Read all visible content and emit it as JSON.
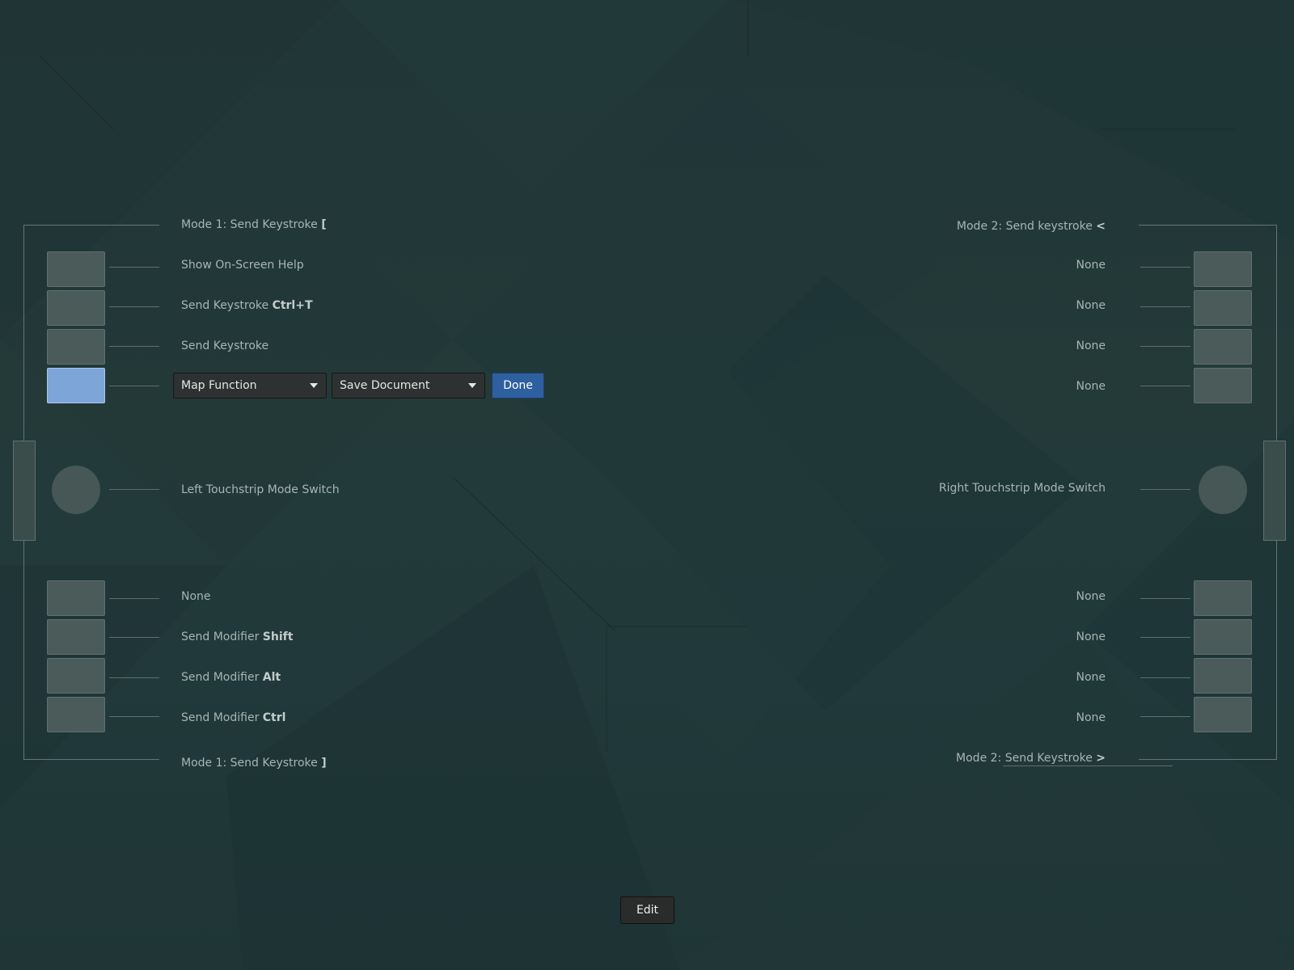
{
  "left": {
    "top_mode": {
      "prefix": "Mode 1: Send Keystroke ",
      "key": "["
    },
    "buttons": [
      {
        "text": "Show On-Screen Help",
        "key": ""
      },
      {
        "text": "Send Keystroke ",
        "key": "Ctrl+T"
      },
      {
        "text": "Send Keystroke",
        "key": ""
      }
    ],
    "mapping": {
      "function": "Map Function",
      "action": "Save Document",
      "done": "Done"
    },
    "touchstrip": "Left Touchstrip Mode Switch",
    "lower_buttons": [
      {
        "text": "None",
        "key": ""
      },
      {
        "text": "Send Modifier ",
        "key": "Shift"
      },
      {
        "text": "Send Modifier ",
        "key": "Alt"
      },
      {
        "text": "Send Modifier ",
        "key": "Ctrl"
      }
    ],
    "bottom_mode": {
      "prefix": "Mode 1: Send Keystroke ",
      "key": "]"
    }
  },
  "right": {
    "top_mode": {
      "prefix": "Mode 2: Send keystroke ",
      "key": "<"
    },
    "buttons": [
      "None",
      "None",
      "None",
      "None"
    ],
    "touchstrip": "Right Touchstrip Mode Switch",
    "lower_buttons": [
      "None",
      "None",
      "None",
      "None"
    ],
    "bottom_mode": {
      "prefix": "Mode 2: Send Keystroke ",
      "key": ">"
    }
  },
  "footer": {
    "edit": "Edit"
  },
  "colors": {
    "background": "#213637",
    "active_button": "#7ea5d8",
    "done_button": "#2e5f9f"
  }
}
